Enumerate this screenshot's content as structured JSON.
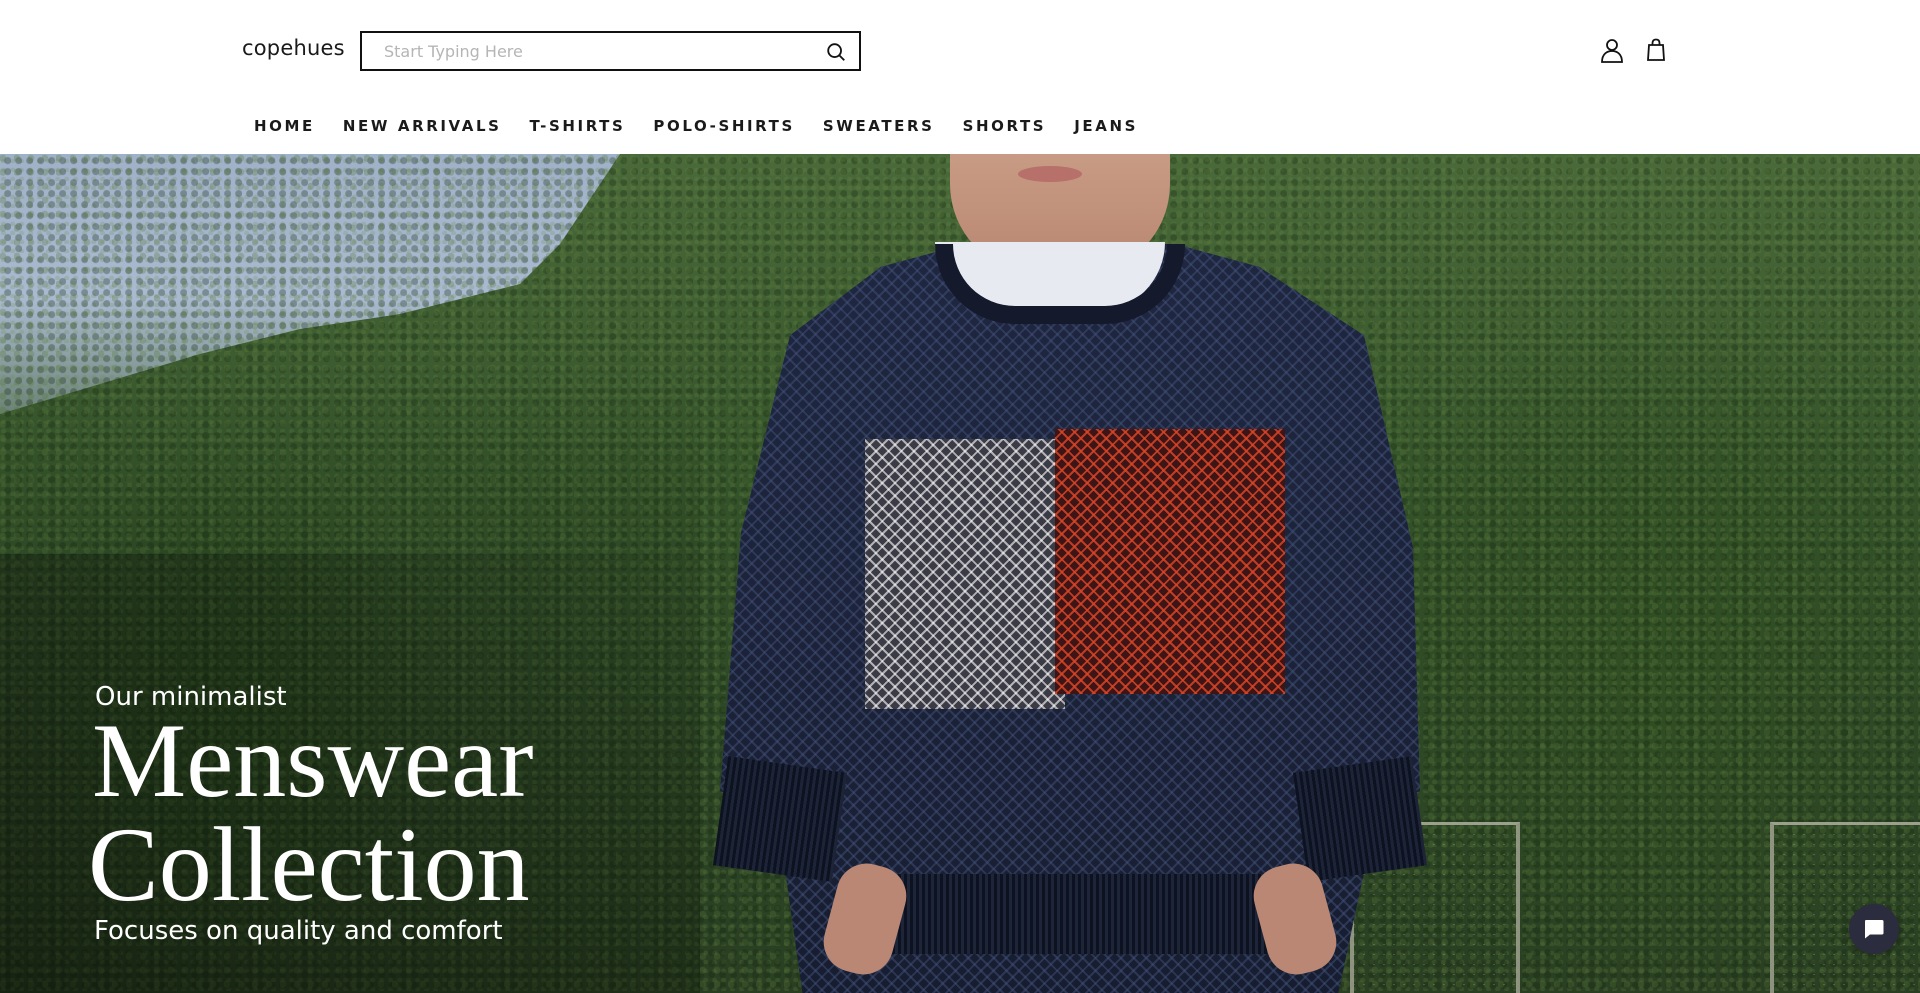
{
  "header": {
    "logo": "copehues",
    "search": {
      "placeholder": "Start Typing Here",
      "value": "",
      "icon": "search-icon"
    },
    "icons": {
      "account": "user-icon",
      "cart": "shopping-bag-icon"
    }
  },
  "nav": {
    "items": [
      {
        "label": "HOME"
      },
      {
        "label": "NEW ARRIVALS"
      },
      {
        "label": "T-SHIRTS"
      },
      {
        "label": "POLO-SHIRTS"
      },
      {
        "label": "SWEATERS"
      },
      {
        "label": "SHORTS"
      },
      {
        "label": "JEANS"
      }
    ]
  },
  "hero": {
    "eyebrow": "Our minimalist",
    "title_line_1": "Menswear",
    "title_line_2": "Collection",
    "subtitle": "Focuses on quality and comfort"
  },
  "chat": {
    "icon": "chat-bubble-icon"
  },
  "colors": {
    "text": "#111111",
    "hero_text": "#ffffff",
    "chat_button": "#2b2d3f"
  }
}
